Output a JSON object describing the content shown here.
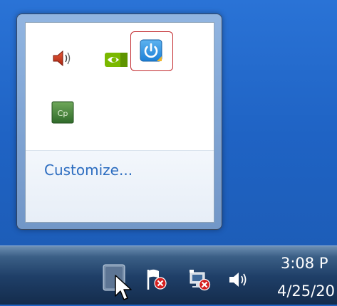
{
  "flyout": {
    "customize_label": "Customize..."
  },
  "tray_icons": [
    {
      "name": "speaker-tray-icon"
    },
    {
      "name": "nvidia-tray-icon"
    },
    {
      "name": "power-app-tray-icon"
    },
    {
      "name": "captivate-tray-icon",
      "text": "Cp"
    }
  ],
  "taskbar": {
    "clock_time": "3:08 P",
    "clock_date": "4/25/20"
  },
  "colors": {
    "desktop": "#1f63c4",
    "link": "#2c6dc0",
    "highlight": "#c2282c"
  }
}
